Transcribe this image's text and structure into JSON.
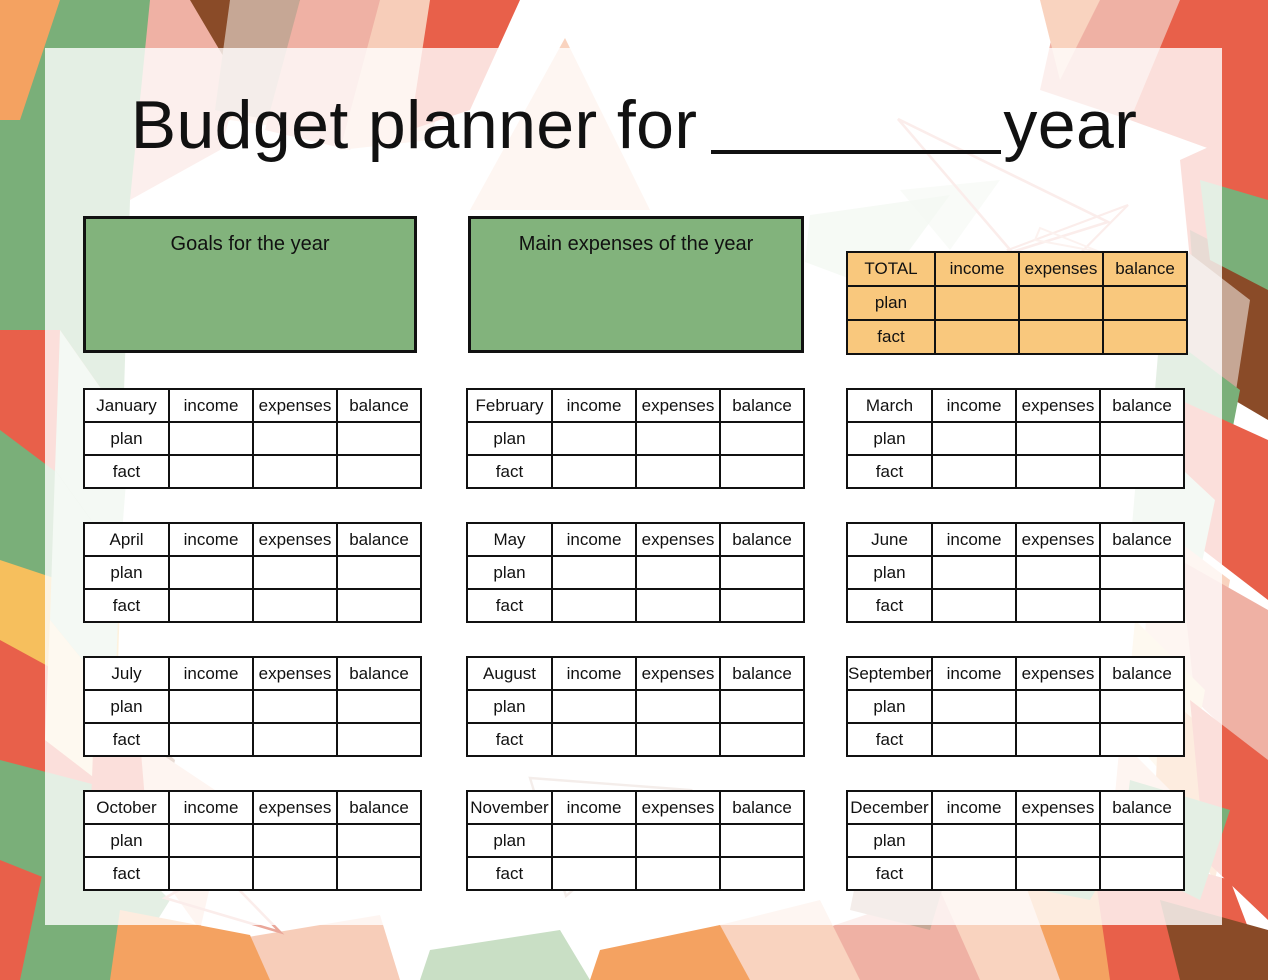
{
  "title": {
    "before_blank": "Budget planner for",
    "blank_placeholder": "",
    "after_blank": "year"
  },
  "notes": {
    "goals_label": "Goals for the year",
    "expenses_label": "Main expenses of the year"
  },
  "colors": {
    "note_green": "#82b37c",
    "total_orange": "#f9c87d",
    "border_black": "#111111",
    "table_white": "#ffffff",
    "poly_green": "#7aaf79",
    "poly_light_green": "#c9dfc5",
    "poly_orange": "#f4a261",
    "poly_red": "#e8604a",
    "poly_brown": "#8a4b28",
    "poly_peach": "#f7cdb9",
    "poly_pink": "#efb1a4",
    "poly_cream": "#fae0b2",
    "poly_amber": "#f6bf5d",
    "poly_taupe": "#c6a795",
    "outline_pink": "#eaa79a"
  },
  "total_table": {
    "name": "TOTAL",
    "columns": [
      "income",
      "expenses",
      "balance"
    ],
    "rows": [
      "plan",
      "fact"
    ],
    "cells": [
      [
        "",
        "",
        ""
      ],
      [
        "",
        "",
        ""
      ]
    ]
  },
  "month_columns": [
    "income",
    "expenses",
    "balance"
  ],
  "month_rows": [
    "plan",
    "fact"
  ],
  "months": [
    {
      "name": "January",
      "cells": [
        [
          "",
          "",
          ""
        ],
        [
          "",
          "",
          ""
        ]
      ]
    },
    {
      "name": "February",
      "cells": [
        [
          "",
          "",
          ""
        ],
        [
          "",
          "",
          ""
        ]
      ]
    },
    {
      "name": "March",
      "cells": [
        [
          "",
          "",
          ""
        ],
        [
          "",
          "",
          ""
        ]
      ]
    },
    {
      "name": "April",
      "cells": [
        [
          "",
          "",
          ""
        ],
        [
          "",
          "",
          ""
        ]
      ]
    },
    {
      "name": "May",
      "cells": [
        [
          "",
          "",
          ""
        ],
        [
          "",
          "",
          ""
        ]
      ]
    },
    {
      "name": "June",
      "cells": [
        [
          "",
          "",
          ""
        ],
        [
          "",
          "",
          ""
        ]
      ]
    },
    {
      "name": "July",
      "cells": [
        [
          "",
          "",
          ""
        ],
        [
          "",
          "",
          ""
        ]
      ]
    },
    {
      "name": "August",
      "cells": [
        [
          "",
          "",
          ""
        ],
        [
          "",
          "",
          ""
        ]
      ]
    },
    {
      "name": "September",
      "cells": [
        [
          "",
          "",
          ""
        ],
        [
          "",
          "",
          ""
        ]
      ]
    },
    {
      "name": "October",
      "cells": [
        [
          "",
          "",
          ""
        ],
        [
          "",
          "",
          ""
        ]
      ]
    },
    {
      "name": "November",
      "cells": [
        [
          "",
          "",
          ""
        ],
        [
          "",
          "",
          ""
        ]
      ]
    },
    {
      "name": "December",
      "cells": [
        [
          "",
          "",
          ""
        ],
        [
          "",
          "",
          ""
        ]
      ]
    }
  ]
}
